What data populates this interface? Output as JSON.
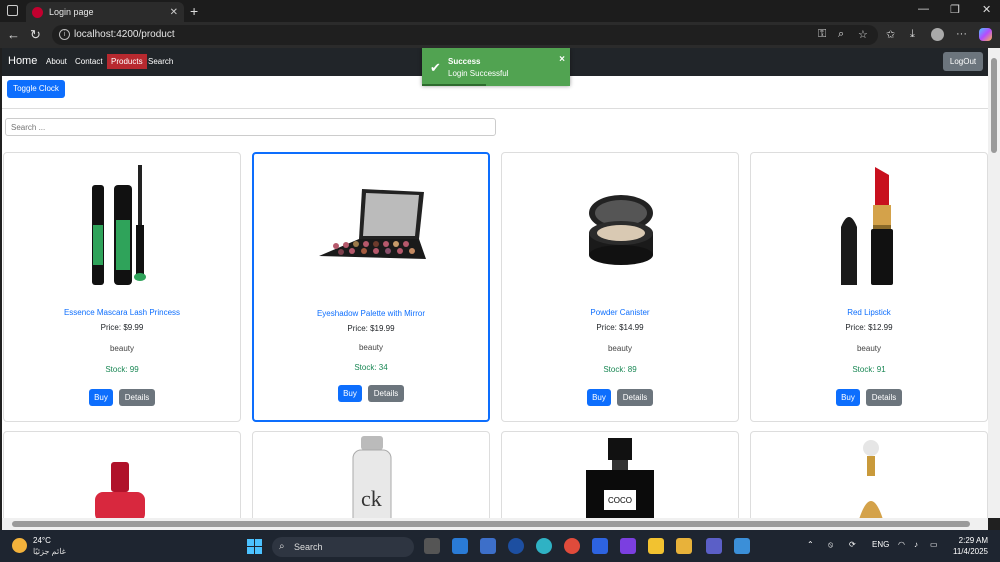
{
  "browser": {
    "tab_title": "Login page",
    "url": "localhost:4200/product"
  },
  "navbar": {
    "brand": "Home",
    "links": [
      "About",
      "Contact",
      "Products",
      "Search"
    ],
    "active_link": "Products",
    "logout_label": "LogOut"
  },
  "toast": {
    "title": "Success",
    "message": "Login Successful",
    "close": "×"
  },
  "toolbar": {
    "toggle_clock_label": "Toggle Clock"
  },
  "search": {
    "placeholder": "Search ..."
  },
  "products": [
    {
      "name": "Essence Mascara Lash Princess",
      "price": "Price: $9.99",
      "category": "beauty",
      "stock": "Stock: 99",
      "buy": "Buy",
      "details": "Details"
    },
    {
      "name": "Eyeshadow Palette with Mirror",
      "price": "Price: $19.99",
      "category": "beauty",
      "stock": "Stock: 34",
      "buy": "Buy",
      "details": "Details"
    },
    {
      "name": "Powder Canister",
      "price": "Price: $14.99",
      "category": "beauty",
      "stock": "Stock: 89",
      "buy": "Buy",
      "details": "Details"
    },
    {
      "name": "Red Lipstick",
      "price": "Price: $12.99",
      "category": "beauty",
      "stock": "Stock: 91",
      "buy": "Buy",
      "details": "Details"
    }
  ],
  "taskbar": {
    "temperature": "24°C",
    "weather_text": "غائم جزئيًا",
    "search_label": "Search",
    "language": "ENG",
    "time": "2:29 AM",
    "date": "11/4/2025"
  },
  "colors": {
    "primary": "#0d6efd",
    "secondary": "#6c757d",
    "success_toast": "#51a351",
    "active_nav": "#b8292f",
    "stock_green": "#198754"
  }
}
